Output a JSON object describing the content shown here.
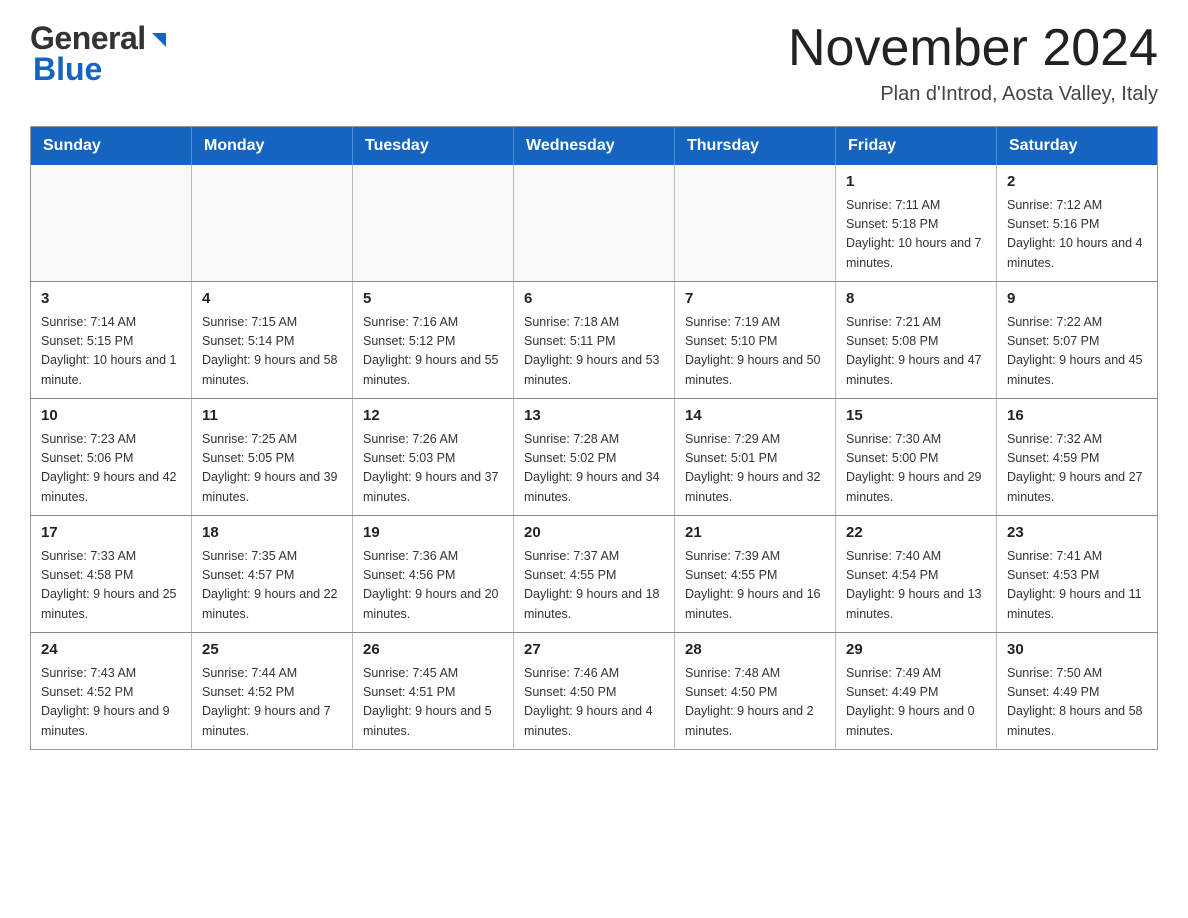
{
  "logo": {
    "general": "General",
    "blue": "Blue",
    "alt": "GeneralBlue logo"
  },
  "title": {
    "month_year": "November 2024",
    "location": "Plan d'Introd, Aosta Valley, Italy"
  },
  "weekdays": [
    "Sunday",
    "Monday",
    "Tuesday",
    "Wednesday",
    "Thursday",
    "Friday",
    "Saturday"
  ],
  "weeks": [
    [
      {
        "day": "",
        "info": ""
      },
      {
        "day": "",
        "info": ""
      },
      {
        "day": "",
        "info": ""
      },
      {
        "day": "",
        "info": ""
      },
      {
        "day": "",
        "info": ""
      },
      {
        "day": "1",
        "info": "Sunrise: 7:11 AM\nSunset: 5:18 PM\nDaylight: 10 hours and 7 minutes."
      },
      {
        "day": "2",
        "info": "Sunrise: 7:12 AM\nSunset: 5:16 PM\nDaylight: 10 hours and 4 minutes."
      }
    ],
    [
      {
        "day": "3",
        "info": "Sunrise: 7:14 AM\nSunset: 5:15 PM\nDaylight: 10 hours and 1 minute."
      },
      {
        "day": "4",
        "info": "Sunrise: 7:15 AM\nSunset: 5:14 PM\nDaylight: 9 hours and 58 minutes."
      },
      {
        "day": "5",
        "info": "Sunrise: 7:16 AM\nSunset: 5:12 PM\nDaylight: 9 hours and 55 minutes."
      },
      {
        "day": "6",
        "info": "Sunrise: 7:18 AM\nSunset: 5:11 PM\nDaylight: 9 hours and 53 minutes."
      },
      {
        "day": "7",
        "info": "Sunrise: 7:19 AM\nSunset: 5:10 PM\nDaylight: 9 hours and 50 minutes."
      },
      {
        "day": "8",
        "info": "Sunrise: 7:21 AM\nSunset: 5:08 PM\nDaylight: 9 hours and 47 minutes."
      },
      {
        "day": "9",
        "info": "Sunrise: 7:22 AM\nSunset: 5:07 PM\nDaylight: 9 hours and 45 minutes."
      }
    ],
    [
      {
        "day": "10",
        "info": "Sunrise: 7:23 AM\nSunset: 5:06 PM\nDaylight: 9 hours and 42 minutes."
      },
      {
        "day": "11",
        "info": "Sunrise: 7:25 AM\nSunset: 5:05 PM\nDaylight: 9 hours and 39 minutes."
      },
      {
        "day": "12",
        "info": "Sunrise: 7:26 AM\nSunset: 5:03 PM\nDaylight: 9 hours and 37 minutes."
      },
      {
        "day": "13",
        "info": "Sunrise: 7:28 AM\nSunset: 5:02 PM\nDaylight: 9 hours and 34 minutes."
      },
      {
        "day": "14",
        "info": "Sunrise: 7:29 AM\nSunset: 5:01 PM\nDaylight: 9 hours and 32 minutes."
      },
      {
        "day": "15",
        "info": "Sunrise: 7:30 AM\nSunset: 5:00 PM\nDaylight: 9 hours and 29 minutes."
      },
      {
        "day": "16",
        "info": "Sunrise: 7:32 AM\nSunset: 4:59 PM\nDaylight: 9 hours and 27 minutes."
      }
    ],
    [
      {
        "day": "17",
        "info": "Sunrise: 7:33 AM\nSunset: 4:58 PM\nDaylight: 9 hours and 25 minutes."
      },
      {
        "day": "18",
        "info": "Sunrise: 7:35 AM\nSunset: 4:57 PM\nDaylight: 9 hours and 22 minutes."
      },
      {
        "day": "19",
        "info": "Sunrise: 7:36 AM\nSunset: 4:56 PM\nDaylight: 9 hours and 20 minutes."
      },
      {
        "day": "20",
        "info": "Sunrise: 7:37 AM\nSunset: 4:55 PM\nDaylight: 9 hours and 18 minutes."
      },
      {
        "day": "21",
        "info": "Sunrise: 7:39 AM\nSunset: 4:55 PM\nDaylight: 9 hours and 16 minutes."
      },
      {
        "day": "22",
        "info": "Sunrise: 7:40 AM\nSunset: 4:54 PM\nDaylight: 9 hours and 13 minutes."
      },
      {
        "day": "23",
        "info": "Sunrise: 7:41 AM\nSunset: 4:53 PM\nDaylight: 9 hours and 11 minutes."
      }
    ],
    [
      {
        "day": "24",
        "info": "Sunrise: 7:43 AM\nSunset: 4:52 PM\nDaylight: 9 hours and 9 minutes."
      },
      {
        "day": "25",
        "info": "Sunrise: 7:44 AM\nSunset: 4:52 PM\nDaylight: 9 hours and 7 minutes."
      },
      {
        "day": "26",
        "info": "Sunrise: 7:45 AM\nSunset: 4:51 PM\nDaylight: 9 hours and 5 minutes."
      },
      {
        "day": "27",
        "info": "Sunrise: 7:46 AM\nSunset: 4:50 PM\nDaylight: 9 hours and 4 minutes."
      },
      {
        "day": "28",
        "info": "Sunrise: 7:48 AM\nSunset: 4:50 PM\nDaylight: 9 hours and 2 minutes."
      },
      {
        "day": "29",
        "info": "Sunrise: 7:49 AM\nSunset: 4:49 PM\nDaylight: 9 hours and 0 minutes."
      },
      {
        "day": "30",
        "info": "Sunrise: 7:50 AM\nSunset: 4:49 PM\nDaylight: 8 hours and 58 minutes."
      }
    ]
  ]
}
